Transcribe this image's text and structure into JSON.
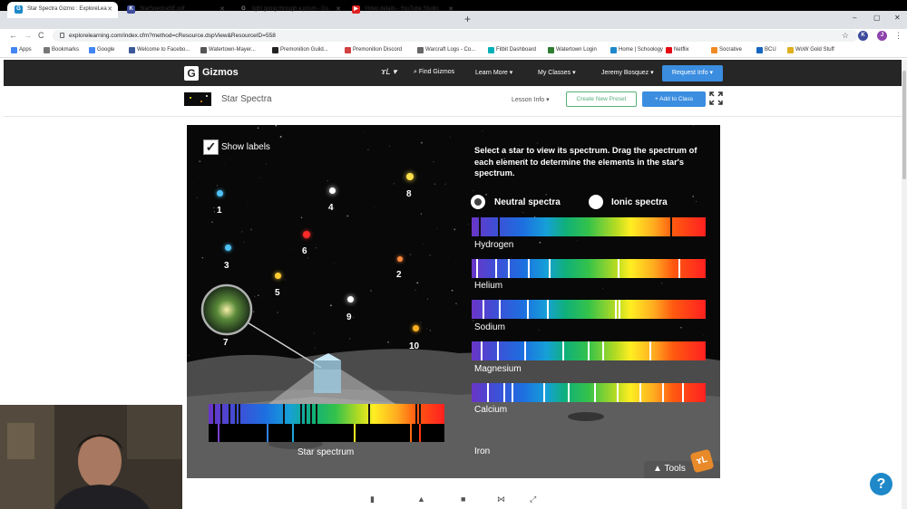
{
  "browser": {
    "tabs": [
      {
        "title": "Star Spectra Gizmo : ExploreLea",
        "favicon": "G",
        "color": "#1e88c9",
        "active": true
      },
      {
        "title": "StarSpectraSE.pdf",
        "favicon": "K",
        "color": "#3d4c9c",
        "active": false
      },
      {
        "title": "light going through a prism - Go",
        "favicon": "G",
        "color": "#888888",
        "active": false
      },
      {
        "title": "Video details - YouTube Studio",
        "favicon": "▶",
        "color": "#e02020",
        "active": false
      }
    ],
    "new_tab": "+",
    "window_controls": [
      "–",
      "▢",
      "✕"
    ],
    "back": "←",
    "forward": "→",
    "reload": "C",
    "url": "explorelearning.com/index.cfm?method=cResource.dspView&ResourceID=558",
    "star_icon": "☆",
    "extensions": [
      {
        "label": "K",
        "color": "#3d4c9c"
      },
      {
        "label": "J",
        "color": "#8e44ad"
      }
    ],
    "menu_dots": "⋮"
  },
  "bookmarks": [
    {
      "label": "Apps",
      "color": "#4285f4"
    },
    {
      "label": "Bookmarks",
      "color": "#777777"
    },
    {
      "label": "Google",
      "color": "#4285f4"
    },
    {
      "label": "Welcome to Facebo...",
      "color": "#3b5998"
    },
    {
      "label": "Watertown-Mayer...",
      "color": "#555555"
    },
    {
      "label": "Premonition Guild...",
      "color": "#222222"
    },
    {
      "label": "Premonition Discord",
      "color": "#d04040"
    },
    {
      "label": "Warcraft Logs - Co...",
      "color": "#666666"
    },
    {
      "label": "Fitbit Dashboard",
      "color": "#00b0b9"
    },
    {
      "label": "Watertown Login",
      "color": "#2e7d32"
    },
    {
      "label": "Home | Schoology",
      "color": "#1e88c9"
    },
    {
      "label": "Netflix",
      "color": "#e50914"
    },
    {
      "label": "Socrative",
      "color": "#f08a24"
    },
    {
      "label": "BCU",
      "color": "#1565c0"
    },
    {
      "label": "WoW Gold Stuff",
      "color": "#e0b020"
    }
  ],
  "gizmos_nav": {
    "logo_letter": "G",
    "brand": "Gizmos",
    "find": "Find Gizmos",
    "learn_more": "Learn More",
    "my_classes": "My Classes",
    "user": "Jeremy Bosquez",
    "request_info": "Request Info"
  },
  "gizmo_header": {
    "title": "Star Spectra",
    "lesson_info": "Lesson Info",
    "new_preset": "Create New Preset",
    "add_to_class": "+ Add to Class"
  },
  "simulation": {
    "show_labels": "Show labels",
    "show_labels_checked": "✓",
    "instructions": "Select a star to view its spectrum. Drag the spectrum of each element to determine the elements in the star's spectrum.",
    "radio_neutral": "Neutral spectra",
    "radio_ionic": "Ionic spectra",
    "stars": [
      "1",
      "2",
      "3",
      "4",
      "5",
      "6",
      "7",
      "8",
      "9",
      "10"
    ],
    "elements": [
      "Hydrogen",
      "Helium",
      "Sodium",
      "Magnesium",
      "Calcium",
      "Iron"
    ],
    "star_spectrum_label": "Star spectrum",
    "tools_label": "Tools",
    "tools_badge": "ɤL"
  },
  "help_label": "?"
}
